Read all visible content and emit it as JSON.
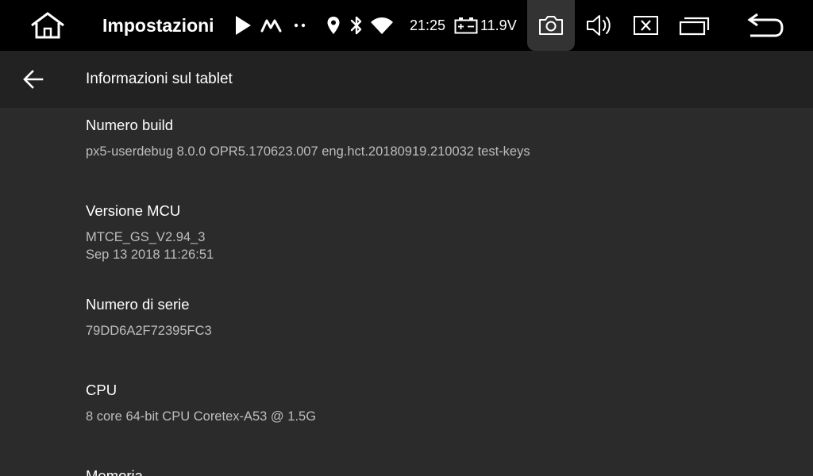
{
  "status_bar": {
    "app_title": "Impostazioni",
    "time": "21:25",
    "voltage": "11.9V",
    "icons": [
      "home-icon",
      "play-icon",
      "maps-icon",
      "more-dots-icon",
      "location-icon",
      "bluetooth-icon",
      "wifi-icon",
      "battery-icon",
      "camera-icon",
      "volume-icon",
      "close-app-icon",
      "recent-apps-icon",
      "back-icon"
    ]
  },
  "action_bar": {
    "title": "Informazioni sul tablet"
  },
  "preferences": [
    {
      "title": "Numero build",
      "summary": "px5-userdebug 8.0.0 OPR5.170623.007 eng.hct.20180919.210032 test-keys"
    },
    {
      "title": "Versione MCU",
      "summary_line1": "MTCE_GS_V2.94_3",
      "summary_line2": "Sep 13 2018 11:26:51"
    },
    {
      "title": "Numero di serie",
      "summary": "79DD6A2F72395FC3"
    },
    {
      "title": "CPU",
      "summary": "8 core 64-bit CPU Coretex-A53 @ 1.5G"
    },
    {
      "title": "Memoria"
    }
  ]
}
